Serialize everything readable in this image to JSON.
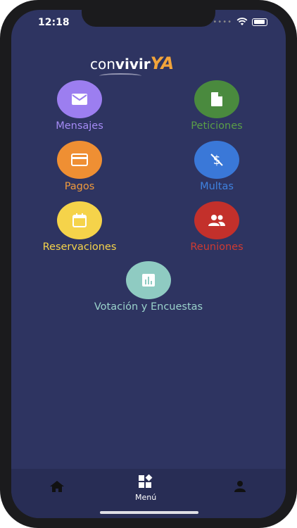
{
  "status_bar": {
    "time": "12:18"
  },
  "logo": {
    "part1": "con",
    "part2": "vivir",
    "part3": "YA"
  },
  "menu": {
    "mensajes": {
      "label": "Mensajes",
      "color": "#9c7ef0",
      "text_color": "#a58bf5",
      "icon": "mail-icon"
    },
    "peticiones": {
      "label": "Peticiones",
      "color": "#4a8a3e",
      "text_color": "#5a9e47",
      "icon": "document-icon"
    },
    "pagos": {
      "label": "Pagos",
      "color": "#ef8f33",
      "text_color": "#f09a3c",
      "icon": "credit-card-icon"
    },
    "multas": {
      "label": "Multas",
      "color": "#3a78d8",
      "text_color": "#3f82e0",
      "icon": "money-off-icon"
    },
    "reservaciones": {
      "label": "Reservaciones",
      "color": "#f5d34a",
      "text_color": "#f5d34a",
      "icon": "calendar-icon"
    },
    "reuniones": {
      "label": "Reuniones",
      "color": "#c3302b",
      "text_color": "#cf3a31",
      "icon": "people-icon"
    },
    "votacion": {
      "label": "Votación y Encuestas",
      "color": "#8fcbc2",
      "text_color": "#9ad2cb",
      "icon": "poll-icon"
    }
  },
  "tabbar": {
    "menu_label": "Menú"
  }
}
